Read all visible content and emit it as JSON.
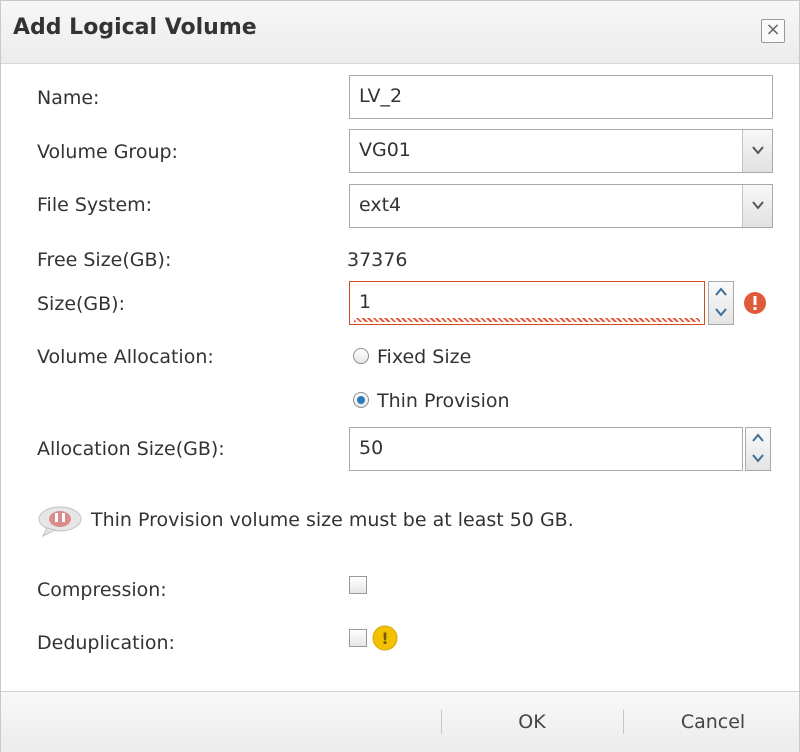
{
  "dialog": {
    "title": "Add Logical Volume",
    "close_glyph": "×"
  },
  "form": {
    "name": {
      "label": "Name:",
      "value": "LV_2"
    },
    "volume_group": {
      "label": "Volume Group:",
      "value": "VG01"
    },
    "file_system": {
      "label": "File System:",
      "value": "ext4"
    },
    "free_size": {
      "label": "Free Size(GB):",
      "value": "37376"
    },
    "size": {
      "label": "Size(GB):",
      "value": "1",
      "state": "error"
    },
    "volume_allocation": {
      "label": "Volume Allocation:",
      "options": [
        {
          "label": "Fixed Size",
          "selected": false
        },
        {
          "label": "Thin Provision",
          "selected": true
        }
      ]
    },
    "allocation_size": {
      "label": "Allocation Size(GB):",
      "value": "50"
    },
    "info_message": "Thin Provision volume size must be at least 50 GB.",
    "compression": {
      "label": "Compression:",
      "checked": false
    },
    "deduplication": {
      "label": "Deduplication:",
      "checked": false,
      "warning_glyph": "!"
    }
  },
  "footer": {
    "ok_label": "OK",
    "cancel_label": "Cancel"
  },
  "colors": {
    "error": "#e05a3a",
    "warning": "#f2c200",
    "radio_selected": "#2a7bb8",
    "info_bubble": "#d98c8c"
  },
  "icons": [
    "close-icon",
    "chevron-down-icon",
    "spin-up-icon",
    "spin-down-icon",
    "error-icon",
    "info-bubble-icon",
    "warning-icon"
  ]
}
